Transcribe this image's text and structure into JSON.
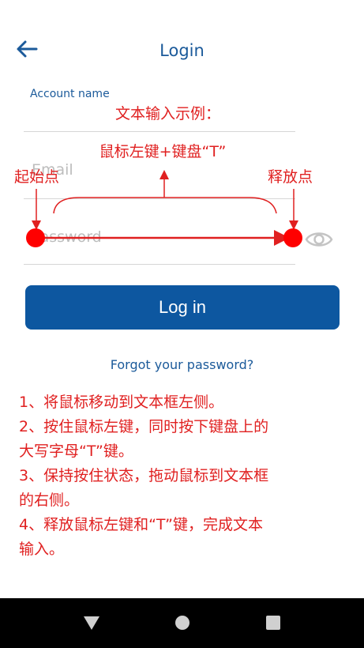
{
  "header": {
    "title": "Login",
    "back_icon": "arrow-left-icon"
  },
  "form": {
    "account_label": "Account name",
    "email_placeholder": "Email",
    "password_placeholder": "Password",
    "visibility_icon": "eye-icon",
    "login_label": "Log in",
    "forgot_label": "Forgot your password?"
  },
  "annotation": {
    "title": "文本输入示例：",
    "subtitle": "鼠标左键+键盘“T”",
    "start_label": "起始点",
    "end_label": "释放点",
    "steps": [
      "1、将鼠标移动到文本框左侧。",
      "2、按住鼠标左键，同时按下键盘上的",
      "大写字母“T”键。",
      "3、保持按住状态，拖动鼠标到文本框",
      "的右侧。",
      "4、释放鼠标左键和“T”键，完成文本",
      "输入。"
    ]
  },
  "navbar": {
    "back_icon": "triangle-back-icon",
    "home_icon": "circle-home-icon",
    "recents_icon": "square-recents-icon"
  },
  "colors": {
    "brand": "#0d57a0",
    "link": "#1b5a9a",
    "annotation": "#e02020"
  }
}
